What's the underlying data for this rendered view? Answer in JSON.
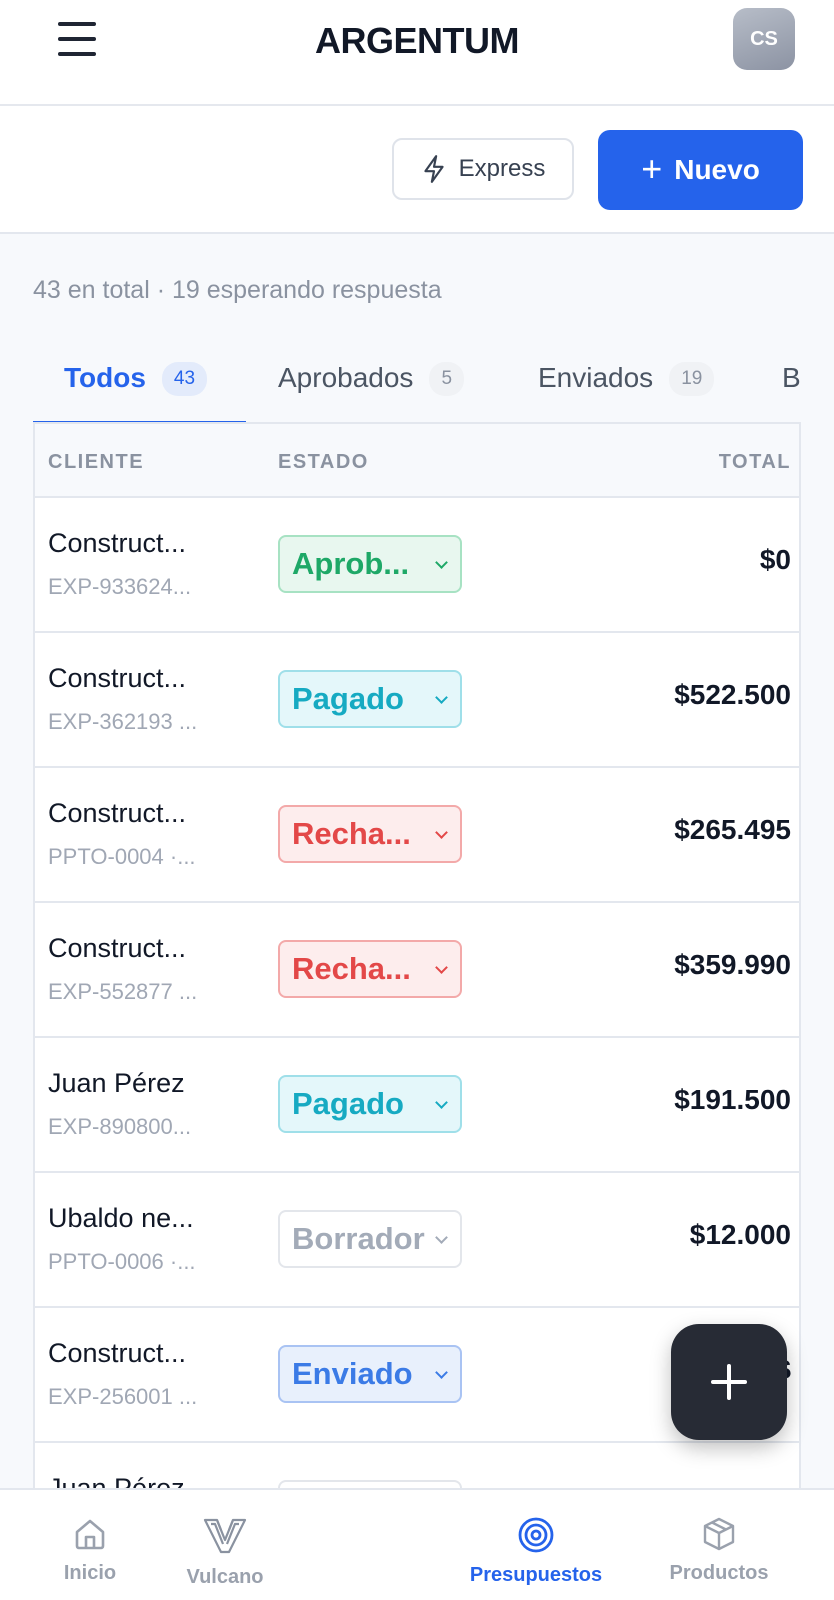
{
  "header": {
    "title": "ARGENTUM",
    "avatar_initials": "CS"
  },
  "actions": {
    "express_label": "Express",
    "new_label": "Nuevo"
  },
  "summary": "43 en total · 19 esperando respuesta",
  "tabs": [
    {
      "label": "Todos",
      "count": "43",
      "active": true
    },
    {
      "label": "Aprobados",
      "count": "5"
    },
    {
      "label": "Enviados",
      "count": "19"
    },
    {
      "label": "B"
    }
  ],
  "table": {
    "columns": [
      "CLIENTE",
      "ESTADO",
      "TOTAL"
    ],
    "rows": [
      {
        "client": "Construct...",
        "ref": "EXP-933624...",
        "status": "Aprob...",
        "status_kind": "aprobado",
        "total": "$0"
      },
      {
        "client": "Construct...",
        "ref": "EXP-362193 ...",
        "status": "Pagado",
        "status_kind": "pagado",
        "total": "$522.500"
      },
      {
        "client": "Construct...",
        "ref": "PPTO-0004 ·...",
        "status": "Recha...",
        "status_kind": "rechazado",
        "total": "$265.495"
      },
      {
        "client": "Construct...",
        "ref": "EXP-552877 ...",
        "status": "Recha...",
        "status_kind": "rechazado",
        "total": "$359.990"
      },
      {
        "client": "Juan Pérez",
        "ref": "EXP-890800...",
        "status": "Pagado",
        "status_kind": "pagado",
        "total": "$191.500"
      },
      {
        "client": "Ubaldo ne...",
        "ref": "PPTO-0006 ·...",
        "status": "Borrador",
        "status_kind": "borrador",
        "total": "$12.000"
      },
      {
        "client": "Construct...",
        "ref": "EXP-256001 ...",
        "status": "Enviado",
        "status_kind": "enviado",
        "total": "$"
      },
      {
        "client": "Juan Pérez",
        "ref": "",
        "status": "",
        "status_kind": "empty",
        "total": ""
      }
    ]
  },
  "bottom_nav": [
    {
      "label": "Inicio",
      "icon": "home-icon"
    },
    {
      "label": "Vulcano",
      "icon": "vulcano-logo-icon"
    },
    {
      "label": "Presupuestos",
      "icon": "target-icon",
      "active": true
    },
    {
      "label": "Productos",
      "icon": "box-icon"
    }
  ],
  "colors": {
    "accent": "#2563eb",
    "approved": "#1ea867",
    "paid": "#16aac2",
    "rejected": "#e34848",
    "draft": "#a3abb8",
    "sent": "#3b7be6",
    "fab": "#272b35"
  }
}
